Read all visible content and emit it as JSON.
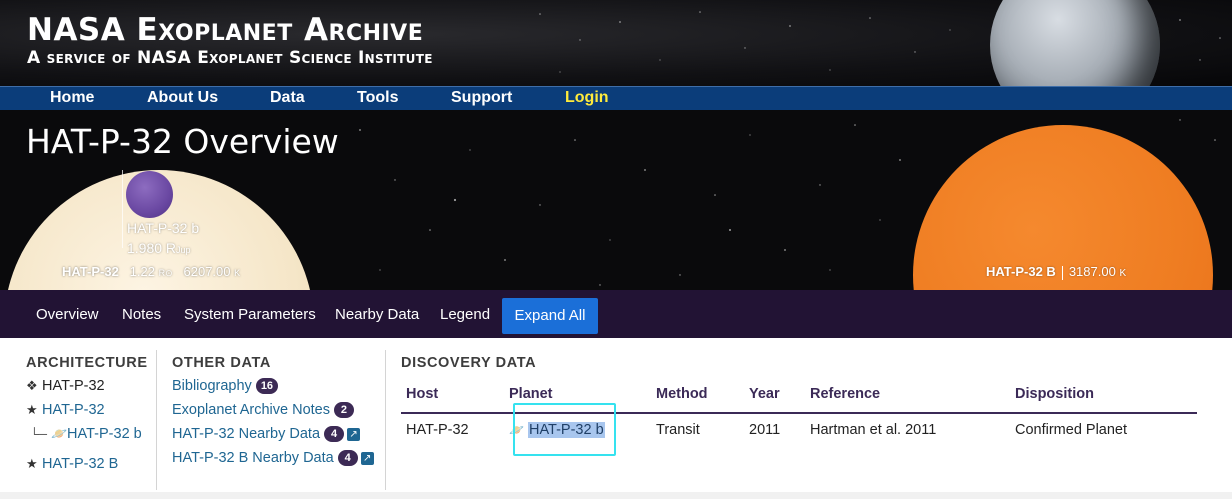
{
  "site": {
    "title": "NASA Exoplanet Archive",
    "subtitle": "A service of NASA Exoplanet Science Institute"
  },
  "topnav": {
    "items": [
      "Home",
      "About Us",
      "Data",
      "Tools",
      "Support"
    ],
    "login": "Login",
    "login_color": "#ffeb3b"
  },
  "hero": {
    "title": "HAT-P-32 Overview",
    "planet_name": "HAT-P-32 b",
    "planet_radius_value": "1.980",
    "planet_radius_unit": "Jup",
    "host_name": "HAT-P-32",
    "host_radius_value": "1.22",
    "host_radius_unit": "R",
    "host_temp_value": "6207.00",
    "host_temp_unit": "K",
    "companion_name": "HAT-P-32 B",
    "companion_temp_value": "3187.00",
    "companion_temp_unit": "K",
    "colors": {
      "host_star": "#f5e6c8",
      "planet": "#6a48a2",
      "companion_star": "#ef7d22"
    }
  },
  "subnav": {
    "items": [
      "Overview",
      "Notes",
      "System Parameters",
      "Nearby Data",
      "Legend"
    ],
    "expand_label": "Expand All",
    "expand_color": "#1b6fd8"
  },
  "architecture": {
    "heading": "ARCHITECTURE",
    "system": {
      "label": "HAT-P-32",
      "icon": "system-icon"
    },
    "host": {
      "label": "HAT-P-32",
      "icon": "star-icon"
    },
    "planet": {
      "label": "HAT-P-32 b",
      "icon": "planet-icon"
    },
    "companion": {
      "label": "HAT-P-32 B",
      "icon": "star-icon"
    }
  },
  "other_data": {
    "heading": "OTHER DATA",
    "items": [
      {
        "label": "Bibliography",
        "count": "16",
        "external": false
      },
      {
        "label": "Exoplanet Archive Notes",
        "count": "2",
        "external": false
      },
      {
        "label": "HAT-P-32 Nearby Data",
        "count": "4",
        "external": true
      },
      {
        "label": "HAT-P-32 B Nearby Data",
        "count": "4",
        "external": true
      }
    ]
  },
  "discovery": {
    "heading": "DISCOVERY DATA",
    "columns": [
      "Host",
      "Planet",
      "Method",
      "Year",
      "Reference",
      "Disposition"
    ],
    "row": {
      "host": "HAT-P-32",
      "planet": "HAT-P-32 b",
      "method": "Transit",
      "year": "2011",
      "reference": "Hartman et al. 2011",
      "disposition": "Confirmed Planet"
    }
  }
}
